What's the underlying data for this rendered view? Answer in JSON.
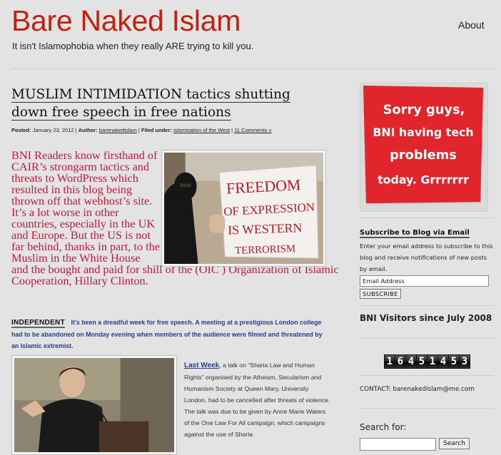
{
  "site": {
    "title": "Bare Naked Islam",
    "tagline": "It isn't Islamophobia when they really ARE trying to kill you.",
    "nav_about": "About"
  },
  "post": {
    "title": "MUSLIM INTIMIDATION tactics shutting down free speech in free nations",
    "meta": {
      "posted_label": "Posted:",
      "date": "January 23, 2012",
      "author_label": "Author:",
      "author": "barenakedislam",
      "filed_label": "Filed under:",
      "category": "islamization of the West",
      "comments": "11 Comments »"
    },
    "lead": "BNI Readers know firsthand of CAIR’s strongarm tactics and threats to WordPress which resulted in this blog being thrown off that webhost’s site. It’s a lot worse in other countries, especially in the UK and Europe. But the US is not far behind, thanks in part, to the Muslim in the White House and the bought and paid for shill of the (OIC ) Organization of Islamic Cooperation, Hillary Clinton.",
    "image1_sign": [
      "FREEDOM",
      "OF EXPRESSION",
      "IS WESTERN",
      "TERRORISM"
    ],
    "source_label": "INDEPENDENT",
    "source_text": "It’s been a dreadful week for free speech. A meeting at a prestigious London college had to be abandoned on Monday evening when members of the audience were filmed and threatened by an Islamic extremist.",
    "body_link": "Last Week",
    "body_text": ", a talk on “Sharia Law and Human Rights” organised by the Atheism, Secularism and Humanism Society at Queen Mary, University London, had to be cancelled after threats of violence. The talk was due to be given by Anne Marie Waters of the One Law For All campaign, which campaigns against the use of Sharia"
  },
  "sidebar": {
    "note_lines": [
      "Sorry guys,",
      "BNI having tech",
      "problems",
      "today. Grrrrrrr"
    ],
    "subscribe_title": "Subscribe to Blog via Email",
    "subscribe_desc": "Enter your email address to subscribe to this blog and receive notifications of new posts by email.",
    "email_placeholder": "Email Address",
    "subscribe_button": "SUBSCRIBE",
    "visitors_title": "BNI Visitors since July 2008",
    "counter_digits": [
      "1",
      "6",
      "4",
      "5",
      "1",
      "4",
      "5",
      "3"
    ],
    "contact": "CONTACT: barenakedislam@me.com",
    "search_label": "Search for:",
    "search_button": "Search"
  },
  "colors": {
    "title_red": "#c4200f",
    "lead_crimson": "#c01a44",
    "link_blue": "#2a3f8f",
    "note_red": "#e0252d",
    "background": "#e3e3e3"
  }
}
